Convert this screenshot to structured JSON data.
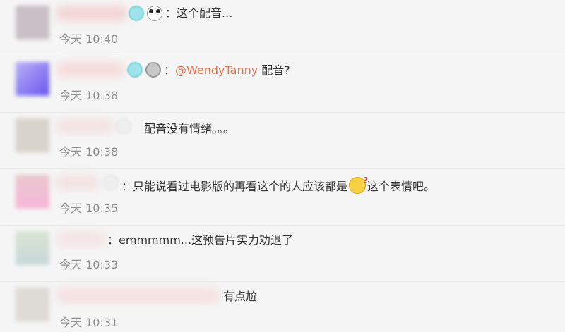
{
  "colors": {
    "mention": "#eb7350",
    "time": "#8f8f8f",
    "divider": "#e6e6e6"
  },
  "comments": [
    {
      "text": "这个配音...",
      "time": "今天 10:40"
    },
    {
      "mention": "@WendyTanny",
      "text": "配音?",
      "time": "今天 10:38"
    },
    {
      "text": "配音没有情绪。。。",
      "time": "今天 10:38"
    },
    {
      "text_before_emoji": "只能说看过电影版的再看这个的人应该都是",
      "emoji": "thinking-face-emoji",
      "text_after_emoji": "这个表情吧。",
      "time": "今天 10:35"
    },
    {
      "text": "emmmmm...这预告片实力劝退了",
      "time": "今天 10:33"
    },
    {
      "text": "有点尬",
      "time": "今天 10:31"
    }
  ]
}
